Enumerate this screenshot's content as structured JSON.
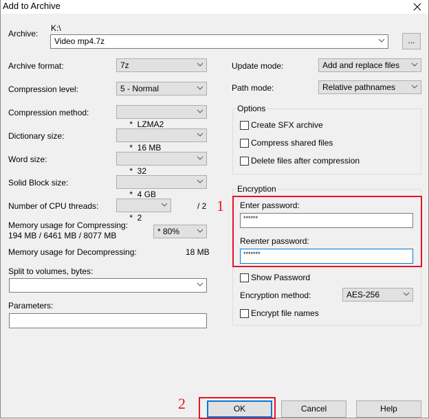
{
  "window": {
    "title": "Add to Archive",
    "close_icon": "close-icon"
  },
  "archive": {
    "label": "Archive:",
    "path": "K:\\",
    "filename": "Video mp4.7z",
    "browse_label": "..."
  },
  "left": {
    "archive_format": {
      "label": "Archive format:",
      "value": "7z"
    },
    "compression_level": {
      "label": "Compression level:",
      "value": "5 - Normal"
    },
    "compression_method": {
      "label": "Compression method:",
      "value": "*  LZMA2"
    },
    "dictionary_size": {
      "label": "Dictionary size:",
      "value": "*  16 MB"
    },
    "word_size": {
      "label": "Word size:",
      "value": "*  32"
    },
    "solid_block_size": {
      "label": "Solid Block size:",
      "value": "*  4 GB"
    },
    "cpu_threads": {
      "label": "Number of CPU threads:",
      "value": "*  2",
      "max": "/ 2"
    },
    "memory_compress": {
      "label": "Memory usage for Compressing:",
      "detail": "194 MB / 6461 MB / 8077 MB",
      "value": "* 80%"
    },
    "memory_decompress": {
      "label": "Memory usage for Decompressing:",
      "value": "18 MB"
    },
    "split_volumes": {
      "label": "Split to volumes, bytes:",
      "value": ""
    },
    "parameters": {
      "label": "Parameters:",
      "value": ""
    }
  },
  "right": {
    "update_mode": {
      "label": "Update mode:",
      "value": "Add and replace files"
    },
    "path_mode": {
      "label": "Path mode:",
      "value": "Relative pathnames"
    },
    "options": {
      "title": "Options",
      "items": [
        {
          "label": "Create SFX archive",
          "checked": false
        },
        {
          "label": "Compress shared files",
          "checked": false
        },
        {
          "label": "Delete files after compression",
          "checked": false
        }
      ]
    },
    "encryption": {
      "title": "Encryption",
      "enter_password_label": "Enter password:",
      "enter_password_value": "******",
      "reenter_password_label": "Reenter password:",
      "reenter_password_value": "*******",
      "show_password_label": "Show Password",
      "show_password_checked": false,
      "method_label": "Encryption method:",
      "method_value": "AES-256",
      "encrypt_names_label": "Encrypt file names",
      "encrypt_names_checked": false
    }
  },
  "annotations": {
    "marker_1": "1",
    "marker_2": "2",
    "highlight_color": "#e81123"
  },
  "buttons": {
    "ok": "OK",
    "cancel": "Cancel",
    "help": "Help"
  }
}
